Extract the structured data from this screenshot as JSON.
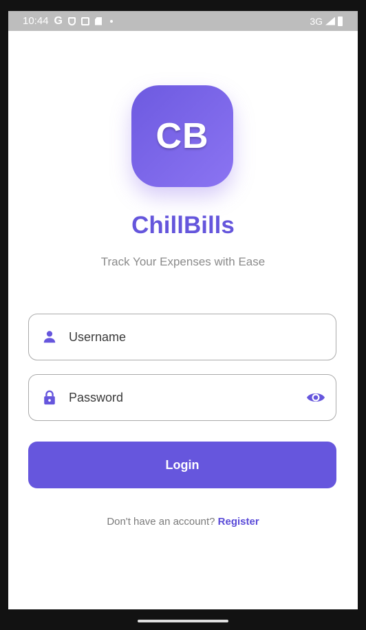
{
  "status_bar": {
    "time": "10:44",
    "g_label": "G",
    "network": "3G",
    "icons": [
      "google-icon",
      "shield-icon",
      "sim-icon",
      "sd-card-icon",
      "dot-icon",
      "signal-icon",
      "battery-icon"
    ]
  },
  "app": {
    "logo_text": "CB",
    "title": "ChillBills",
    "subtitle": "Track Your Expenses with Ease"
  },
  "form": {
    "username_placeholder": "Username",
    "password_placeholder": "Password",
    "login_label": "Login"
  },
  "register": {
    "prompt": "Don't have an account?",
    "link": "Register"
  },
  "colors": {
    "primary": "#6656dd",
    "title": "#6556dc",
    "subtitle": "#8a8a8a",
    "field_border": "#a9a9a9"
  }
}
